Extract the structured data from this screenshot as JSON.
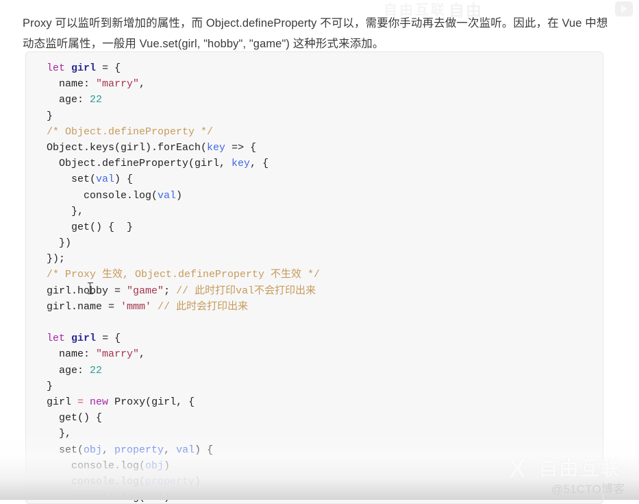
{
  "page": {
    "background_color": "#ffffff",
    "intro_paragraph": "Proxy 可以监听到新增加的属性，而 Object.defineProperty 不可以，需要你手动再去做一次监听。因此，在 Vue 中想动态监听属性，一般用 Vue.set(girl, \"hobby\", \"game\") 这种形式来添加。"
  },
  "code_block": {
    "background_color": "#f7f7f8",
    "border_color": "#e6e6e8",
    "language": "javascript",
    "lines": [
      "let girl = {",
      "  name: \"marry\",",
      "  age: 22",
      "}",
      "/* Object.defineProperty */",
      "Object.keys(girl).forEach(key => {",
      "  Object.defineProperty(girl, key, {",
      "    set(val) {",
      "      console.log(val)",
      "    },",
      "    get() {  }",
      "  })",
      "});",
      "/* Proxy 生效, Object.defineProperty 不生效 */",
      "girl.hobby = \"game\"; // 此时打印val不会打印出来",
      "girl.name = 'mmm' // 此时会打印出来",
      "",
      "let girl = {",
      "  name: \"marry\",",
      "  age: 22",
      "}",
      "girl = new Proxy(girl, {",
      "  get() {",
      "  },",
      "  set(obj, property, val) {",
      "    console.log(obj)",
      "    console.log(property)",
      "    console.log(val)"
    ],
    "token_colors": {
      "keyword": "#a626a4",
      "variable": "#2b2b8f",
      "operator": "#d14a79",
      "string": "#a4364b",
      "number": "#2a9d8f",
      "comment": "#c79b59",
      "parameter": "#4169e1",
      "plain": "#222222"
    }
  },
  "watermark": {
    "logo_x": "X",
    "logo_text": "自由互联",
    "handle": "@51CTO博客",
    "top_badge": "play-badge"
  }
}
